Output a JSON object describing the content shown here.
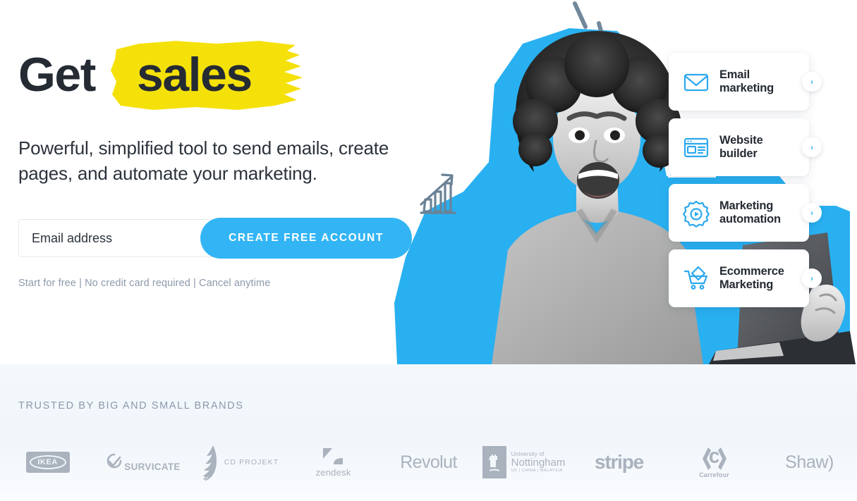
{
  "hero": {
    "headline_part1": "Get",
    "headline_part2": "sales",
    "subheadline": "Powerful, simplified tool to send emails, create pages, and automate your marketing.",
    "highlight_color": "#f5e10a",
    "text_color": "#252b33"
  },
  "signup": {
    "email_placeholder": "Email address",
    "email_value": "",
    "cta_label": "CREATE FREE ACCOUNT",
    "cta_color": "#33b5f5",
    "fineprint": "Start for free | No credit card required | Cancel anytime"
  },
  "artwork": {
    "cutout_color": "#29b0f1",
    "doodle_color": "#6a8296",
    "icons": [
      "growth-chart-doodle",
      "burst-strokes",
      "woman-with-laptop-photo"
    ]
  },
  "feature_cards": [
    {
      "label": "Email\nmarketing",
      "icon": "envelope-icon",
      "chevron": "›"
    },
    {
      "label": "Website\nbuilder",
      "icon": "browser-window-icon",
      "chevron": "›"
    },
    {
      "label": "Marketing\nautomation",
      "icon": "gear-play-icon",
      "chevron": "›"
    },
    {
      "label": "Ecommerce\nMarketing",
      "icon": "shopping-cart-icon",
      "chevron": "›"
    }
  ],
  "brands": {
    "title": "TRUSTED BY BIG AND SMALL BRANDS",
    "items": [
      {
        "name": "IKEA",
        "text": "IKEA"
      },
      {
        "name": "Survicate",
        "text": "SURVICATE"
      },
      {
        "name": "CD PROJEKT",
        "text": "CD PROJEKT"
      },
      {
        "name": "zendesk",
        "text": "zendesk"
      },
      {
        "name": "Revolut",
        "text": "Revolut"
      },
      {
        "name": "University of Nottingham",
        "line1": "University of",
        "line2": "Nottingham",
        "line3": "UK | CHINA | MALAYSIA"
      },
      {
        "name": "stripe",
        "text": "stripe"
      },
      {
        "name": "Carrefour",
        "text": "Carrefour"
      },
      {
        "name": "Shaw",
        "text": "Shaw)"
      }
    ]
  }
}
